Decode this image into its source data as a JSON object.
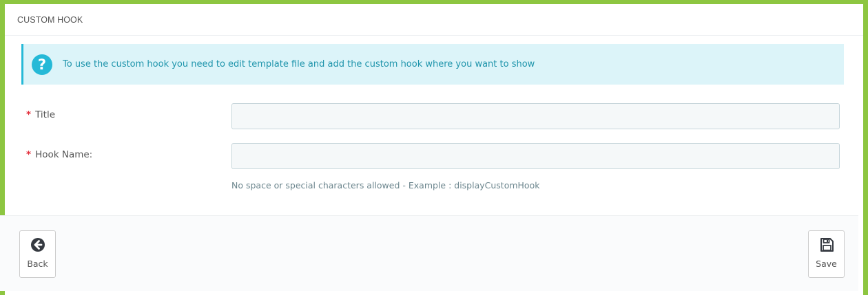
{
  "panel": {
    "heading": "CUSTOM HOOK"
  },
  "alert": {
    "icon": "question-circle-icon",
    "text": "To use the custom hook you need to edit template file and add the custom hook where you want to show",
    "colors": {
      "background": "#dcf4f9",
      "accent": "#25b9d7",
      "text": "#1e94ab"
    }
  },
  "form": {
    "required_marker": "*",
    "title": {
      "label": "Title",
      "value": ""
    },
    "hook_name": {
      "label": "Hook Name:",
      "value": "",
      "help": "No space or special characters allowed - Example : displayCustomHook"
    }
  },
  "footer": {
    "back_label": "Back",
    "back_icon": "arrow-circle-left-icon",
    "save_label": "Save",
    "save_icon": "floppy-disk-icon"
  },
  "colors": {
    "frame": "#8dc641",
    "required": "#e3303d"
  }
}
